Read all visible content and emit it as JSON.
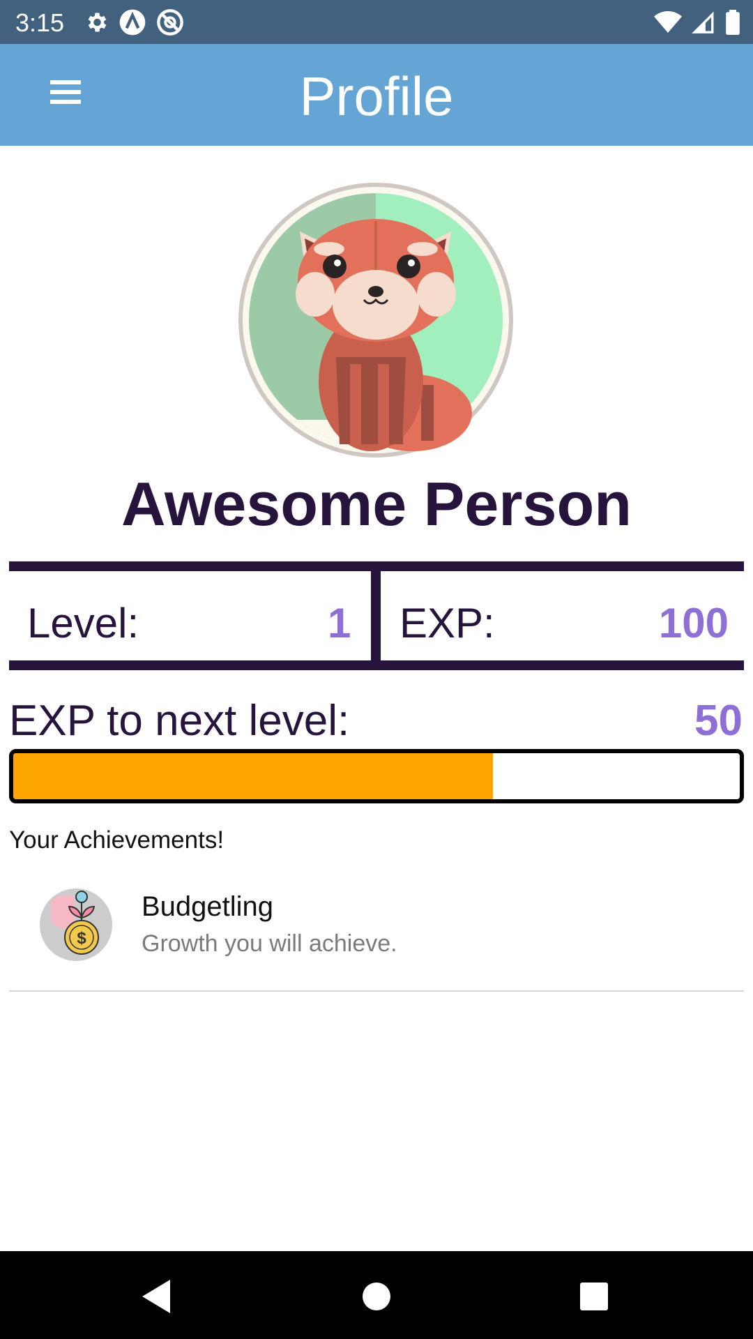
{
  "status_bar": {
    "time": "3:15",
    "left_icons": [
      "gear-icon",
      "a-circle-icon",
      "at-no-icon"
    ],
    "right_icons": [
      "wifi-icon",
      "signal-icon",
      "battery-icon"
    ]
  },
  "app_bar": {
    "title": "Profile",
    "menu_icon": "hamburger-menu-icon"
  },
  "profile": {
    "avatar": "red-panda-avatar",
    "name": "Awesome Person"
  },
  "stats": {
    "level_label": "Level:",
    "level_value": "1",
    "exp_label": "EXP:",
    "exp_value": "100"
  },
  "progress": {
    "label": "EXP to next level:",
    "value": "50",
    "fill_percent": 66
  },
  "achievements": {
    "heading": "Your Achievements!",
    "items": [
      {
        "title": "Budgetling",
        "subtitle": "Growth you will achieve.",
        "icon": "coin-plant-icon"
      }
    ]
  },
  "nav_bar": {
    "buttons": [
      "back-icon",
      "home-icon",
      "recents-icon"
    ]
  },
  "colors": {
    "status_bar": "#42617f",
    "app_bar": "#64a5d6",
    "dark_text": "#26143c",
    "accent_value": "#8d6fd6",
    "progress_fill": "#ffa500"
  }
}
